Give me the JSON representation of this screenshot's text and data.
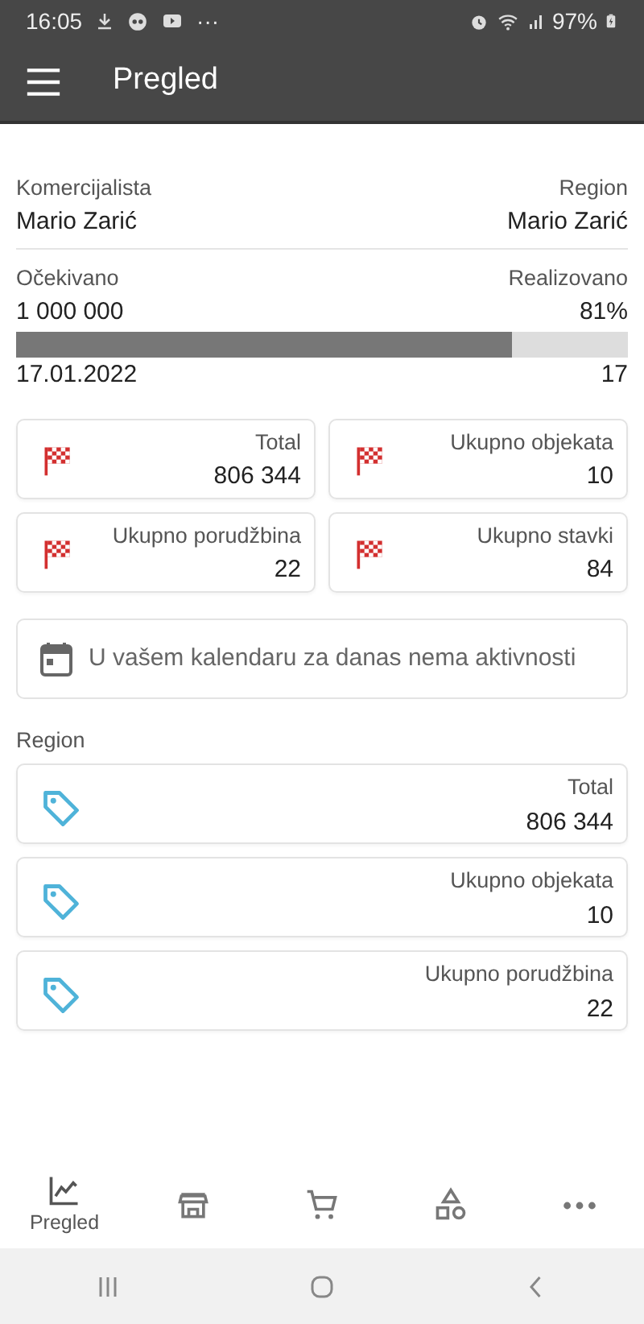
{
  "status_bar": {
    "time": "16:05",
    "more": "···",
    "battery": "97%"
  },
  "app_bar": {
    "title": "Pregled"
  },
  "header": {
    "left_label": "Komercijalista",
    "left_value": "Mario Zarić",
    "right_label": "Region",
    "right_value": "Mario Zarić"
  },
  "progress": {
    "left_label": "Očekivano",
    "left_value": "1 000 000",
    "right_label": "Realizovano",
    "right_value": "81%",
    "level": 0.81,
    "date": "17.01.2022",
    "count": "17"
  },
  "stats": [
    {
      "label": "Total",
      "value": "806 344"
    },
    {
      "label": "Ukupno objekata",
      "value": "10"
    },
    {
      "label": "Ukupno porudžbina",
      "value": "22"
    },
    {
      "label": "Ukupno stavki",
      "value": "84"
    }
  ],
  "calendar_notice": "U vašem kalendaru za danas nema aktivnosti",
  "region": {
    "title": "Region",
    "items": [
      {
        "label": "Total",
        "value": "806 344"
      },
      {
        "label": "Ukupno objekata",
        "value": "10"
      },
      {
        "label": "Ukupno porudžbina",
        "value": "22"
      }
    ]
  },
  "bottom_nav": [
    {
      "kind": "chart",
      "label": "Pregled",
      "selected": true
    },
    {
      "kind": "store",
      "selected": false
    },
    {
      "kind": "cart",
      "selected": false
    },
    {
      "kind": "shapes",
      "selected": false
    },
    {
      "kind": "more",
      "selected": false
    }
  ]
}
